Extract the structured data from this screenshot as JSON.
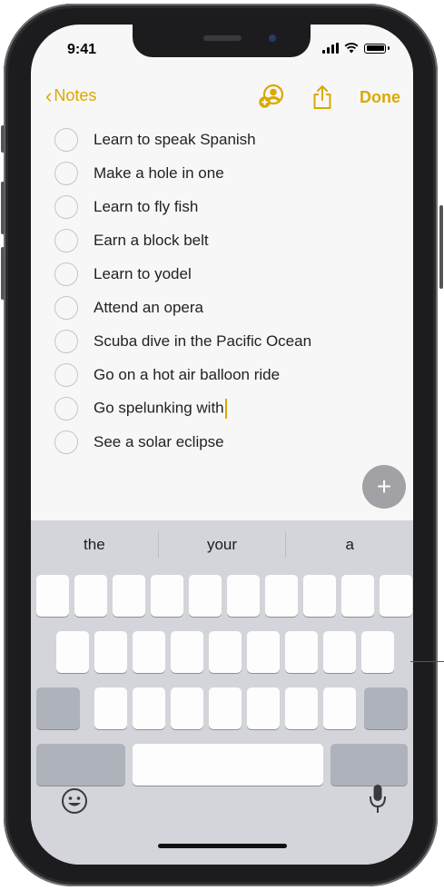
{
  "status_bar": {
    "time": "9:41"
  },
  "nav": {
    "back_label": "Notes",
    "done_label": "Done"
  },
  "accent_color": "#d9a900",
  "checklist": [
    {
      "text": "Learn to speak Spanish",
      "checked": false
    },
    {
      "text": "Make a hole in one",
      "checked": false
    },
    {
      "text": "Learn to fly fish",
      "checked": false
    },
    {
      "text": "Earn a block belt",
      "checked": false
    },
    {
      "text": "Learn to yodel",
      "checked": false
    },
    {
      "text": "Attend an opera",
      "checked": false
    },
    {
      "text": "Scuba dive in the Pacific Ocean",
      "checked": false
    },
    {
      "text": "Go on a hot air balloon ride",
      "checked": false
    },
    {
      "text": "Go spelunking with",
      "checked": false,
      "editing": true
    },
    {
      "text": "See a solar eclipse",
      "checked": false
    }
  ],
  "add_button": {
    "icon": "plus-icon",
    "label": "+"
  },
  "keyboard": {
    "suggestions": [
      "the",
      "your",
      "a"
    ],
    "emoji_icon": "emoji-icon",
    "mic_icon": "microphone-icon"
  },
  "icons": {
    "collaborate": "add-person-icon",
    "share": "share-icon",
    "signal": "signal-icon",
    "wifi": "wifi-icon",
    "battery": "battery-icon"
  }
}
